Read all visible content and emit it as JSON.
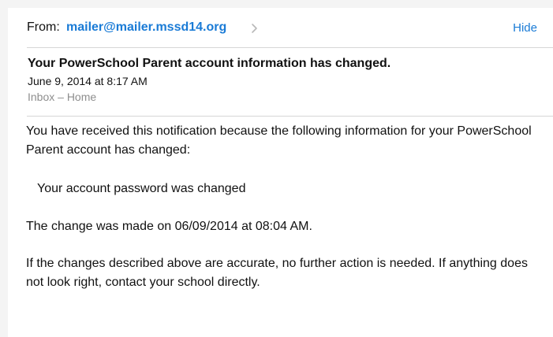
{
  "header": {
    "from_label": "From:",
    "from_address": "mailer@mailer.mssd14.org",
    "hide_label": "Hide"
  },
  "message": {
    "subject": "Your PowerSchool Parent account information has changed.",
    "date": "June 9, 2014 at 8:17 AM",
    "mailbox": "Inbox – Home",
    "body": {
      "paragraph1": "You have received this notification because the following information for your PowerSchool Parent account has changed:",
      "paragraph2": "Your account password was changed",
      "paragraph3": "The change was made on 06/09/2014 at 08:04 AM.",
      "paragraph4": "If the changes described above are accurate, no further action is needed. If anything does not look right, contact your school directly."
    }
  },
  "colors": {
    "link": "#1a7bd6",
    "secondary_text": "#8e8e8e",
    "divider": "#d6d6d6"
  },
  "icons": {
    "sender_disclosure": "chevron-right-icon"
  }
}
